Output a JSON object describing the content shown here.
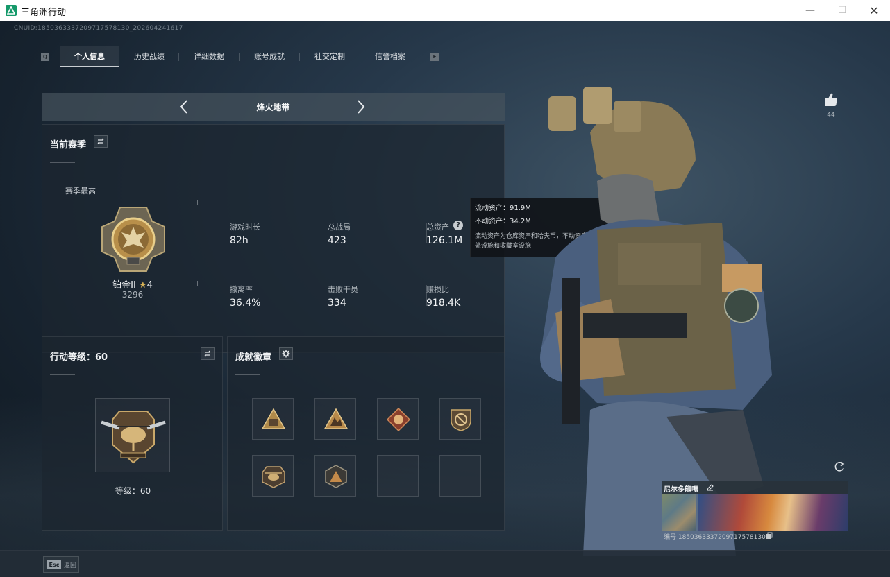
{
  "window": {
    "title": "三角洲行动",
    "minimize": "—",
    "maximize": "☐",
    "close": "✕"
  },
  "cnuid": "CNUID:1850363337209717578130_202604241617",
  "tabs": [
    {
      "label": "个人信息",
      "active": true
    },
    {
      "label": "历史战绩"
    },
    {
      "label": "详细数据"
    },
    {
      "label": "账号成就"
    },
    {
      "label": "社交定制"
    },
    {
      "label": "信誉档案"
    }
  ],
  "tab_keys": {
    "left": "Q",
    "right": "E"
  },
  "mode": {
    "title": "烽火地带"
  },
  "season": {
    "title": "当前赛季",
    "peak_label": "赛季最高",
    "rank_name": "铂金II",
    "rank_star": "★",
    "rank_stars": "4",
    "rank_score": "3296",
    "stats": [
      {
        "label": "游戏时长",
        "value": "82h"
      },
      {
        "label": "总战局",
        "value": "423"
      },
      {
        "label": "总资产",
        "value": "126.1M"
      },
      {
        "label": "撤离率",
        "value": "36.4%"
      },
      {
        "label": "击败干员",
        "value": "334"
      },
      {
        "label": "赚损比",
        "value": "918.4K"
      }
    ],
    "help_glyph": "?"
  },
  "tooltip": {
    "liquid": "流动资产：91.9M",
    "fixed": "不动资产：34.2M",
    "desc": "流动资产为仓库资产和哈夫币，不动资产为特勤处设施和收藏室设施"
  },
  "level": {
    "title": "行动等级：60",
    "text": "等级：60"
  },
  "achievements": {
    "title": "成就徽章",
    "badges": [
      {
        "icon": "triangle-badge-icon",
        "filled": true
      },
      {
        "icon": "creature-badge-icon",
        "filled": true
      },
      {
        "icon": "dragon-badge-icon",
        "filled": true
      },
      {
        "icon": "no-sign-badge-icon",
        "filled": true
      },
      {
        "icon": "helicopter-badge-icon",
        "filled": true
      },
      {
        "icon": "shield-triangle-badge-icon",
        "filled": true
      },
      {
        "icon": "empty-slot",
        "filled": false
      },
      {
        "icon": "empty-slot",
        "filled": false
      }
    ]
  },
  "likes": {
    "count": "44"
  },
  "profile": {
    "name": "尼尔多龍嗎",
    "id": "编号 1850363337209717578130"
  },
  "bottom": {
    "esc_key": "Esc",
    "esc_label": "返回"
  },
  "colors": {
    "accent_gold": "#d8b256",
    "panel_bg": "#1c262f",
    "app_icon": "#15996a"
  }
}
